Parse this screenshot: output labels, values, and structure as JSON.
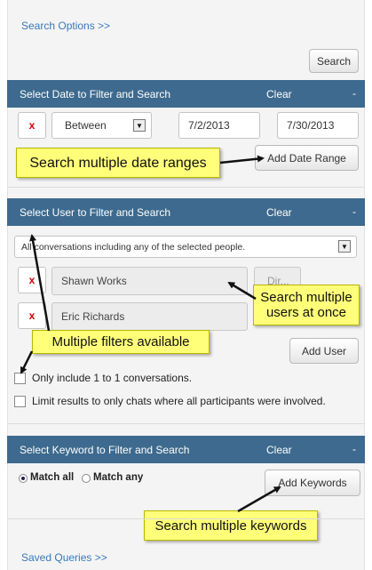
{
  "search_options_link": "Search Options >>",
  "search_button": "Search",
  "date_section": {
    "title": "Select Date to Filter and Search",
    "clear": "Clear",
    "collapse": "-",
    "remove": "x",
    "operator": "Between",
    "start_date": "7/2/2013",
    "end_date": "7/30/2013",
    "add_button": "Add Date Range"
  },
  "user_section": {
    "title": "Select User to Filter and Search",
    "clear": "Clear",
    "collapse": "-",
    "scope_select": "All conversations including any of the selected people.",
    "users": [
      {
        "remove": "x",
        "name": "Shawn Works",
        "dir": "Dir..."
      },
      {
        "remove": "x",
        "name": "Eric Richards"
      }
    ],
    "add_button": "Add User",
    "option_one_to_one": "Only include 1 to 1 conversations.",
    "option_all_participants": "Limit results to only chats where all participants were involved."
  },
  "keyword_section": {
    "title": "Select Keyword to Filter and Search",
    "clear": "Clear",
    "collapse": "-",
    "match_all": "Match all",
    "match_any": "Match any",
    "add_button": "Add Keywords"
  },
  "saved_queries_link": "Saved Queries >>",
  "callouts": {
    "date": "Search multiple date ranges",
    "users_line1": "Search multiple",
    "users_line2": "users at once",
    "filters": "Multiple filters available",
    "keywords": "Search multiple keywords"
  },
  "colors": {
    "header_bar": "#3d6a8e",
    "link": "#3a79b8",
    "callout": "#ffff7a",
    "remove_x": "#d10000"
  }
}
